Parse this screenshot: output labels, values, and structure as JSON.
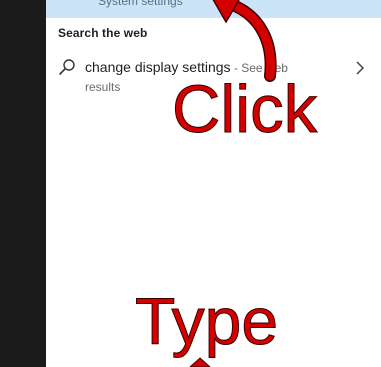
{
  "best_match": {
    "subtitle": "System settings"
  },
  "web_section": {
    "header": "Search the web",
    "result": {
      "query": "change display settings",
      "suffix": " - See web",
      "subline": "results"
    }
  },
  "annotations": {
    "click_label": "Click",
    "type_label": "Type"
  },
  "icons": {
    "search": "search-icon",
    "chevron": "chevron-right-icon",
    "arrow": "curved-arrow-icon"
  },
  "colors": {
    "highlight": "#cce4f7",
    "annotation_red": "#d40000",
    "taskbar": "#1b1b1b"
  }
}
